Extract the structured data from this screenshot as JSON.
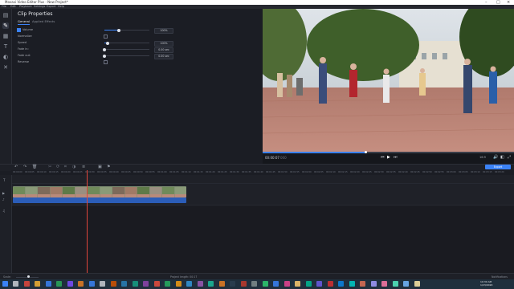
{
  "window": {
    "title": "Movavi Video Editor Plus - New Project*"
  },
  "menu": [
    "File",
    "Edit",
    "Playback",
    "Settings",
    "Export",
    "Help"
  ],
  "sidebar_tools": [
    "import-icon",
    "magic-wand-icon",
    "filters-icon",
    "titles-icon",
    "transitions-icon",
    "more-tools-icon"
  ],
  "props": {
    "title": "Clip Properties",
    "tabs": [
      "General",
      "Applied Effects"
    ],
    "rows": [
      {
        "label": "Volume",
        "checked": true,
        "has_slider": true,
        "value": "100%",
        "level": 0.32
      },
      {
        "label": "Normalize",
        "checked": false,
        "has_slider": false
      },
      {
        "label": "Speed",
        "checked": false,
        "has_slider": true,
        "value": "100%",
        "level": 0.05
      },
      {
        "label": "Fade in:",
        "checked": false,
        "has_slider": true,
        "value": "0.00 sec",
        "level": 0.0
      },
      {
        "label": "Fade out:",
        "checked": false,
        "has_slider": true,
        "value": "0.00 sec",
        "level": 0.0
      },
      {
        "label": "Reverse",
        "checked": false,
        "has_slider": false
      }
    ]
  },
  "player": {
    "time": "00:00:07",
    "time_ms": "000",
    "progress": 0.41,
    "aspect": "16:9"
  },
  "export_label": "Export",
  "ruler_ticks": [
    "00:00:00",
    "00:00:05",
    "00:00:10",
    "00:00:15",
    "00:00:20",
    "00:00:25",
    "00:00:30",
    "00:00:35",
    "00:00:40",
    "00:00:45",
    "00:00:50",
    "00:00:55",
    "00:01:00",
    "00:01:05",
    "00:01:10",
    "00:01:15",
    "00:01:20",
    "00:01:25",
    "00:01:30",
    "00:01:35",
    "00:01:40",
    "00:01:45",
    "00:01:50",
    "00:01:55",
    "00:02:00",
    "00:02:05",
    "00:02:10",
    "00:02:15",
    "00:02:20",
    "00:02:25",
    "00:02:30",
    "00:02:35",
    "00:02:40",
    "00:02:45",
    "00:02:50",
    "00:02:55",
    "00:03:00",
    "00:03:05",
    "00:03:10",
    "00:03:15",
    "00:03:20",
    "00:03:25"
  ],
  "status": {
    "scale_label": "Scale:",
    "project_length": "Project length: 00:17",
    "notifications": "Notifications"
  },
  "taskbar": {
    "time": "10:30 AM",
    "date": "1/23/2020"
  },
  "colors": {
    "accent": "#3b82f6",
    "playhead": "#e0463c"
  }
}
